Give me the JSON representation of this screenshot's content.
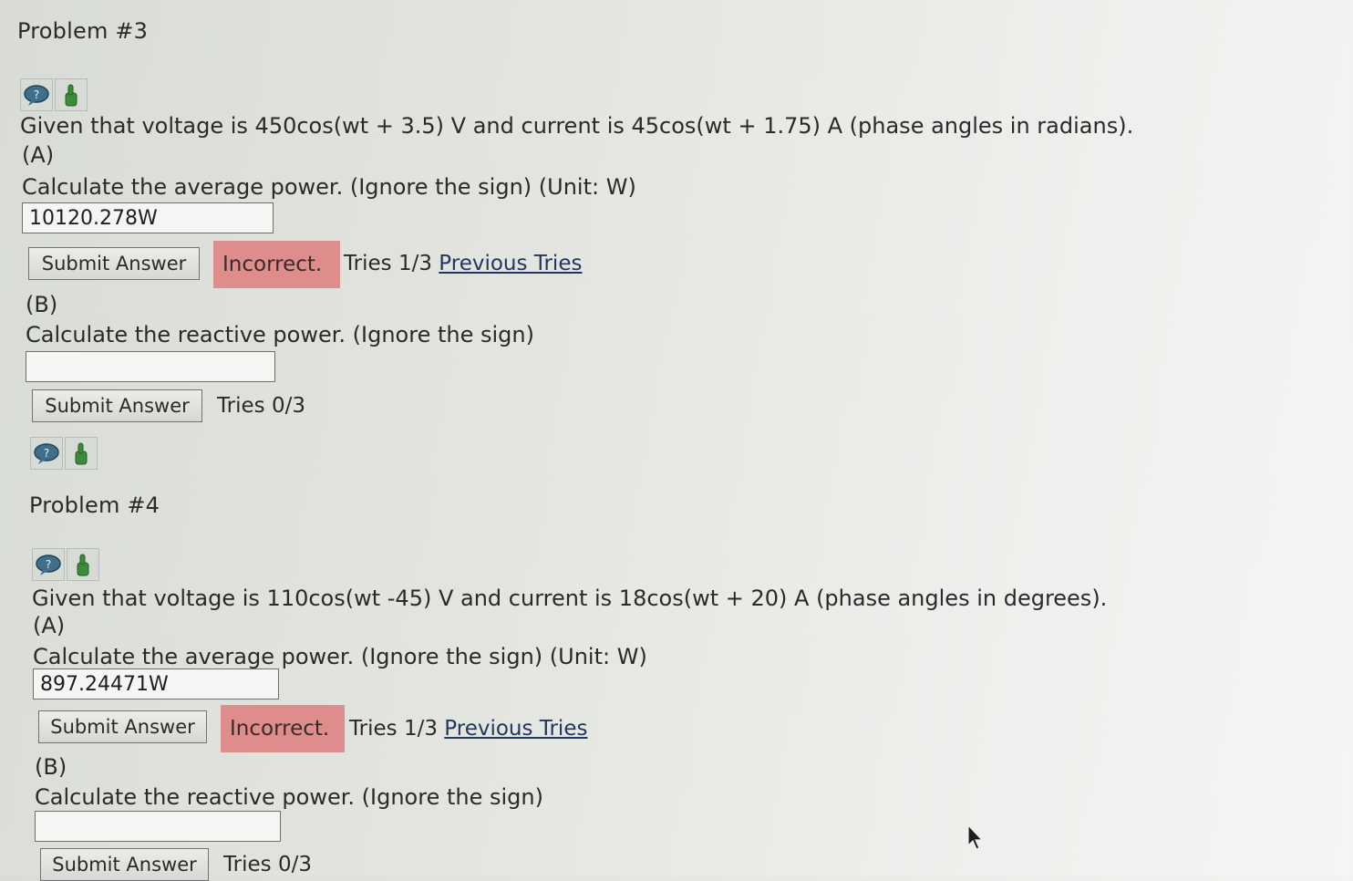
{
  "problems": [
    {
      "title": "Problem #3",
      "statement": "Given that voltage is 450cos(wt + 3.5) V and current is 45cos(wt + 1.75) A (phase angles in radians).",
      "parts": [
        {
          "letter": "(A)",
          "question": "Calculate the average power. (Ignore the sign) (Unit: W)",
          "answer_value": "10120.278W",
          "submit_label": "Submit Answer",
          "status": "Incorrect.",
          "tries": "Tries 1/3",
          "previous_tries_label": "Previous Tries"
        },
        {
          "letter": "(B)",
          "question": "Calculate the reactive power. (Ignore the sign)",
          "answer_value": "",
          "submit_label": "Submit Answer",
          "tries": "Tries 0/3"
        }
      ]
    },
    {
      "title": "Problem #4",
      "statement": "Given that voltage is 110cos(wt -45) V and current is 18cos(wt + 20) A (phase angles in degrees).",
      "parts": [
        {
          "letter": "(A)",
          "question": "Calculate the average power. (Ignore the sign) (Unit: W)",
          "answer_value": "897.24471W",
          "submit_label": "Submit Answer",
          "status": "Incorrect.",
          "tries": "Tries 1/3",
          "previous_tries_label": "Previous Tries"
        },
        {
          "letter": "(B)",
          "question": "Calculate the reactive power. (Ignore the sign)",
          "answer_value": "",
          "submit_label": "Submit Answer",
          "tries": "Tries 0/3"
        }
      ]
    }
  ],
  "icons": {
    "discuss": "discussion-bubble-icon",
    "feedback": "thumbs-up-icon"
  },
  "colors": {
    "incorrect_bg": "#df8c8c",
    "link": "#23365f",
    "icon_blue": "#3f6f8a",
    "icon_green": "#3a8b3a"
  }
}
